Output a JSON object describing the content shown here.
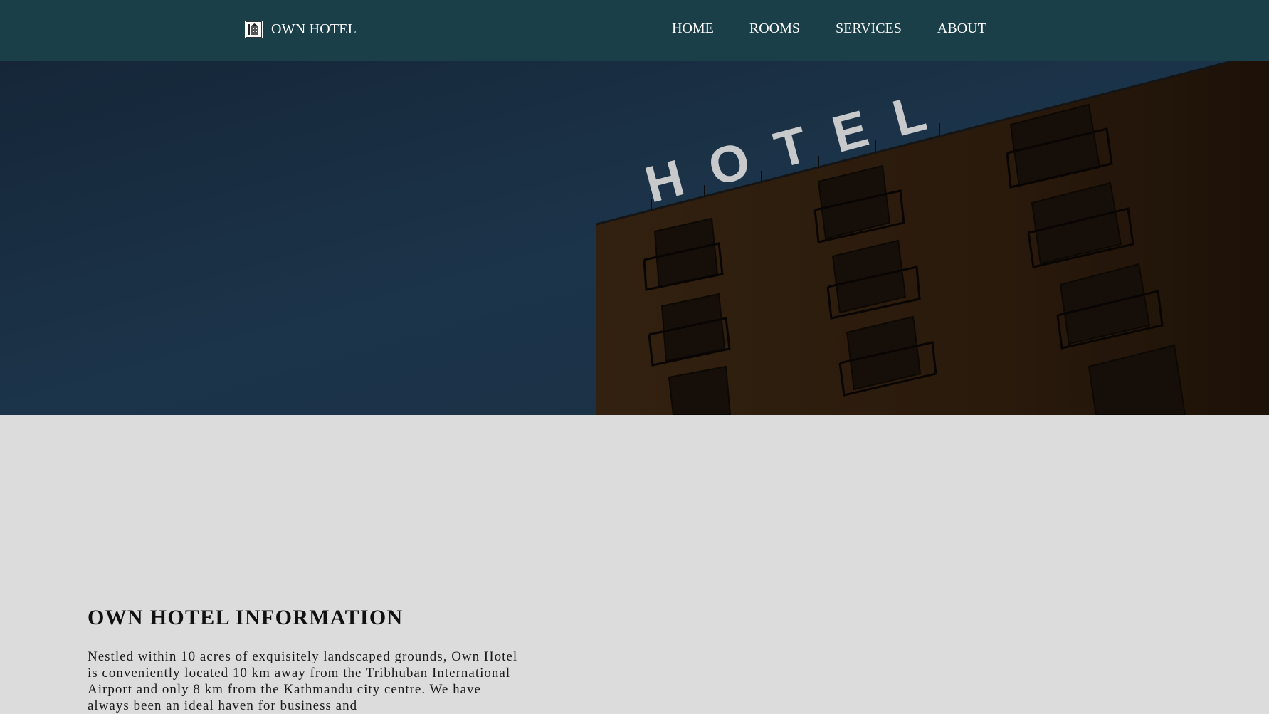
{
  "header": {
    "brand_name": "OWN HOTEL",
    "logo_icon": "hotel-logo-icon",
    "nav": [
      {
        "label": "HOME"
      },
      {
        "label": "ROOMS"
      },
      {
        "label": "SERVICES"
      },
      {
        "label": "ABOUT"
      }
    ],
    "background_color": "#1b3f48"
  },
  "hero": {
    "sign_text": "HOTEL",
    "sky_color": "#20384f",
    "building_color": "#3a2512"
  },
  "info": {
    "title": "OWN HOTEL INFORMATION",
    "text": "Nestled within 10 acres of exquisitely landscaped grounds, Own Hotel is conveniently located 10 km away from the Tribhuban International Airport and only 8 km from the Kathmandu city centre. We have always been an ideal haven for business and"
  },
  "page": {
    "background_color": "#dcdcdd"
  }
}
